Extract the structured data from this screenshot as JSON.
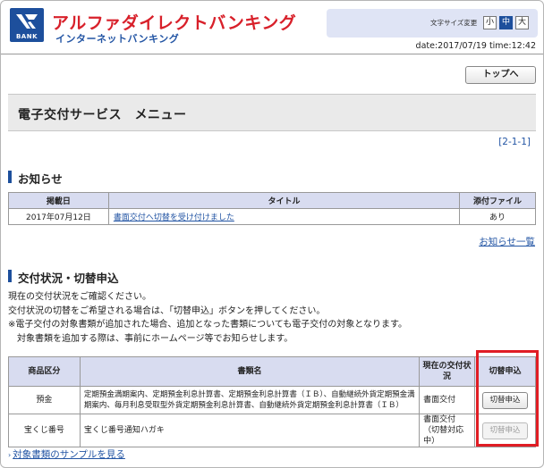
{
  "header": {
    "logo_text": "BANK",
    "brand": "アルファダイレクトバンキング",
    "brand_sub": "インターネットバンキング",
    "fontsize_label": "文字サイズ変更",
    "fontsize_options": [
      "小",
      "中",
      "大"
    ],
    "date_text": "date:2017/07/19 time:12:42"
  },
  "top_button": "トップへ",
  "page_title": "電子交付サービス　メニュー",
  "page_code": "[2-1-1]",
  "news": {
    "heading": "お知らせ",
    "columns": [
      "掲載日",
      "タイトル",
      "添付ファイル"
    ],
    "rows": [
      {
        "date": "2017年07月12日",
        "title": "書面交付へ切替を受け付けました",
        "attachment": "あり"
      }
    ],
    "more_link": "お知らせ一覧"
  },
  "status": {
    "heading": "交付状況・切替申込",
    "lines": [
      "現在の交付状況をご確認ください。",
      "交付状況の切替をご希望される場合は、「切替申込」ボタンを押してください。",
      "※電子交付の対象書類が追加された場合、追加となった書類についても電子交付の対象となります。",
      "　対象書類を追加する際は、事前にホームページ等でお知らせします。"
    ],
    "columns": [
      "商品区分",
      "書類名",
      "現在の交付状況",
      "切替申込"
    ],
    "rows": [
      {
        "category": "預金",
        "docs": "定期預金満期案内、定期預金利息計算書、定期預金利息計算書（ＩＢ）、自動継続外貨定期預金満期案内、毎月利息受取型外貨定期預金利息計算書、自動継続外貨定期預金利息計算書（ＩＢ）",
        "status": "書面交付",
        "button": "切替申込"
      },
      {
        "category": "宝くじ番号",
        "docs": "宝くじ番号通知ハガキ",
        "status": "書面交付（切替対応中）",
        "button": "切替申込"
      }
    ],
    "sample_link": "対象書類のサンプルを見る"
  },
  "colors": {
    "brand_red": "#d8202a",
    "brand_blue": "#1d4f9c",
    "header_th": "#d8dcf0",
    "highlight": "#e01d24"
  }
}
